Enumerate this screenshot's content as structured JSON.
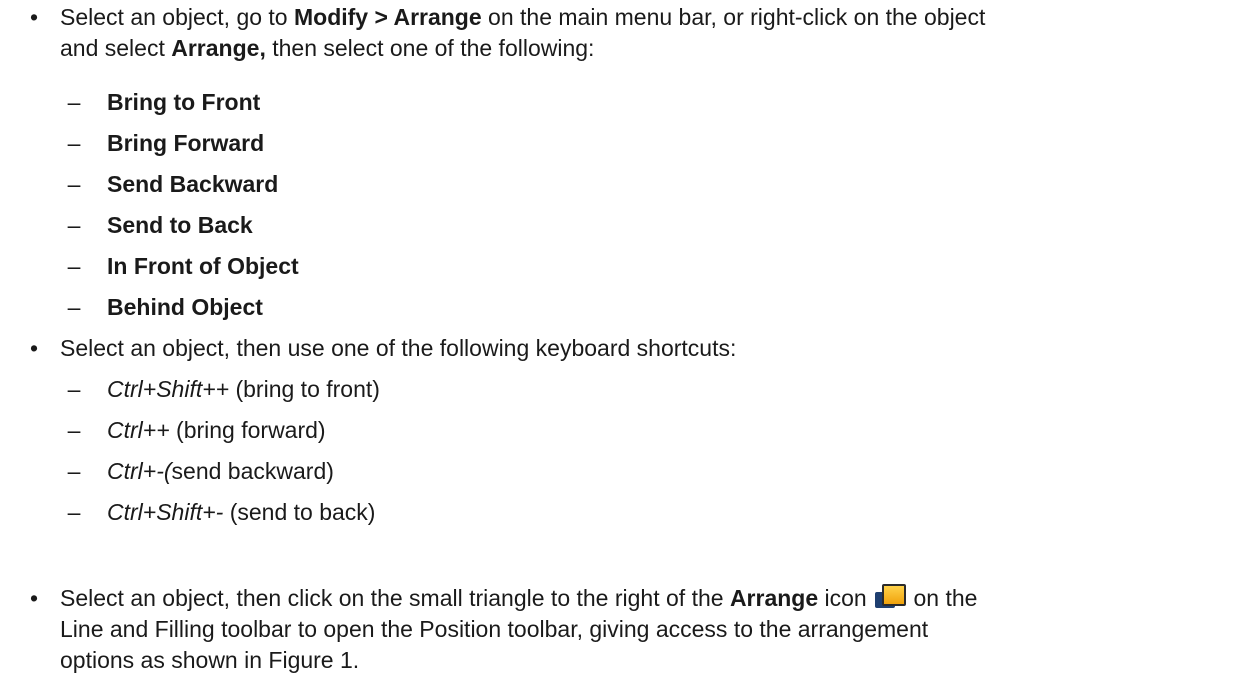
{
  "bullets": [
    {
      "pre": "Select an object, go to ",
      "bold1": "Modify > Arrange",
      "mid": " on the main menu bar, or right-click on the object",
      "line2_pre": "and select ",
      "bold2": "Arrange,",
      "line2_post": " then select one of the following:",
      "items": [
        "Bring to Front",
        "Bring Forward",
        "Send Backward",
        "Send to Back",
        "In Front of Object",
        "Behind Object"
      ]
    },
    {
      "text": "Select an object, then use one of the following keyboard shortcuts:",
      "items": [
        {
          "key": "Ctrl+Shift++",
          "desc": " (bring to front)"
        },
        {
          "key": "Ctrl++",
          "desc": " (bring forward)"
        },
        {
          "key": "Ctrl+-(",
          "desc": "send backward)"
        },
        {
          "key": "Ctrl+Shift+-",
          "desc": " (send to back)"
        }
      ]
    },
    {
      "pre": "Select an object, then click on the small triangle to the right of the ",
      "bold": "Arrange",
      "post_icon": " icon ",
      "line1_end": " on the",
      "line2": "Line and Filling toolbar to open the Position toolbar, giving access to the arrangement",
      "line3": "options as shown in Figure 1."
    }
  ],
  "bullet_glyph": "•",
  "dash_glyph": "–",
  "icons": {
    "arrange": "arrange-icon"
  }
}
